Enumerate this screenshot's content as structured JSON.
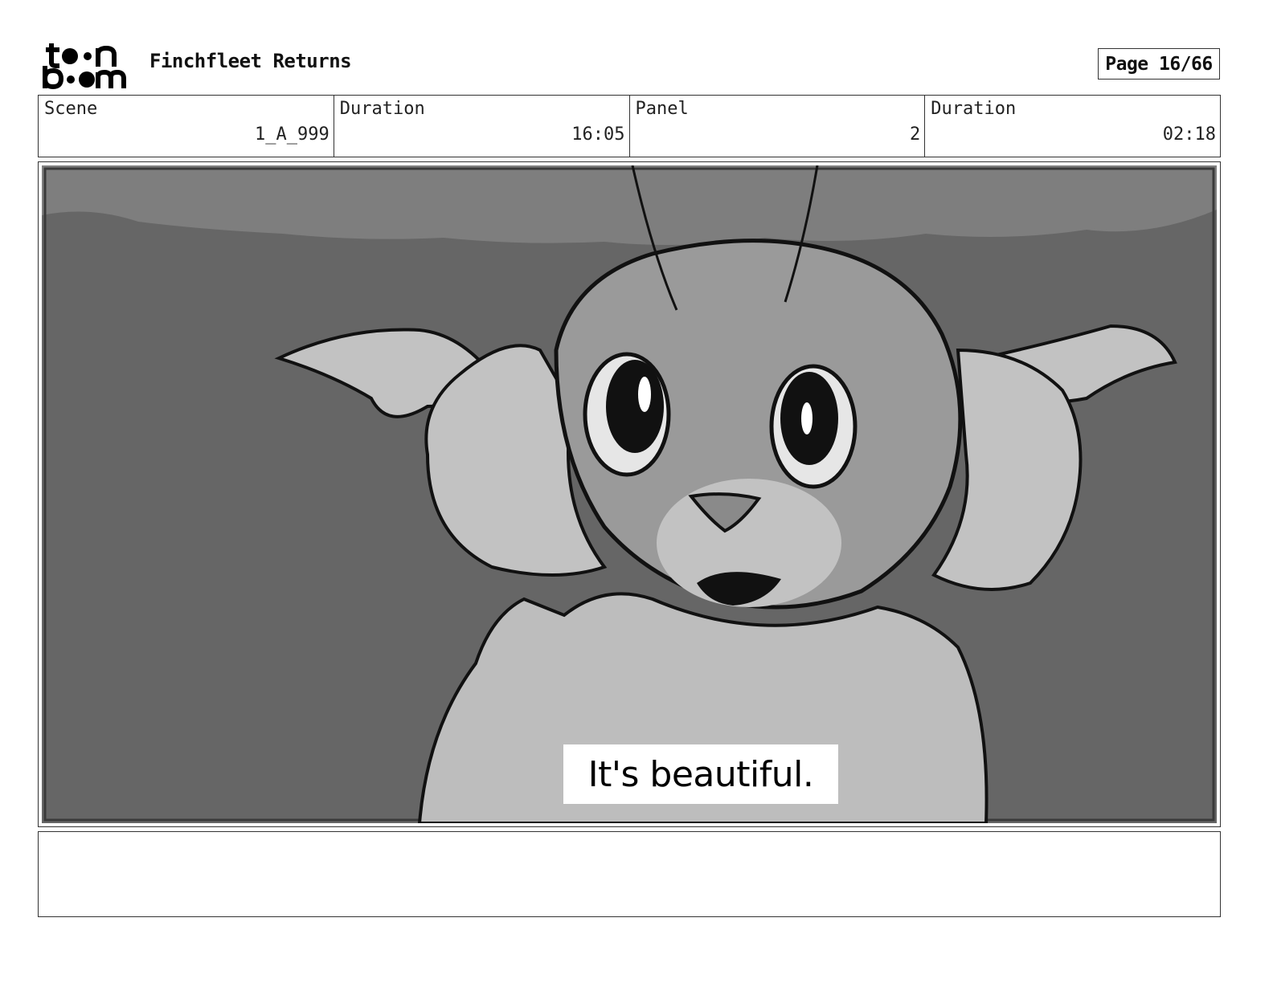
{
  "header": {
    "logo_text": "toon boom",
    "project_title": "Finchfleet Returns",
    "page_label": "Page 16/66"
  },
  "info": {
    "scene_label": "Scene",
    "scene_value": "1_A_999",
    "duration_label": "Duration",
    "duration_value": "16:05",
    "panel_label": "Panel",
    "panel_value": "2",
    "panel_duration_label": "Duration",
    "panel_duration_value": "02:18"
  },
  "panel": {
    "caption": "It's beautiful.",
    "illustration_icon": "cat-character-sketch"
  },
  "colors": {
    "sky": "#7e7e7e",
    "background": "#666666",
    "fur": "#c8c8c8",
    "line": "#111111"
  }
}
